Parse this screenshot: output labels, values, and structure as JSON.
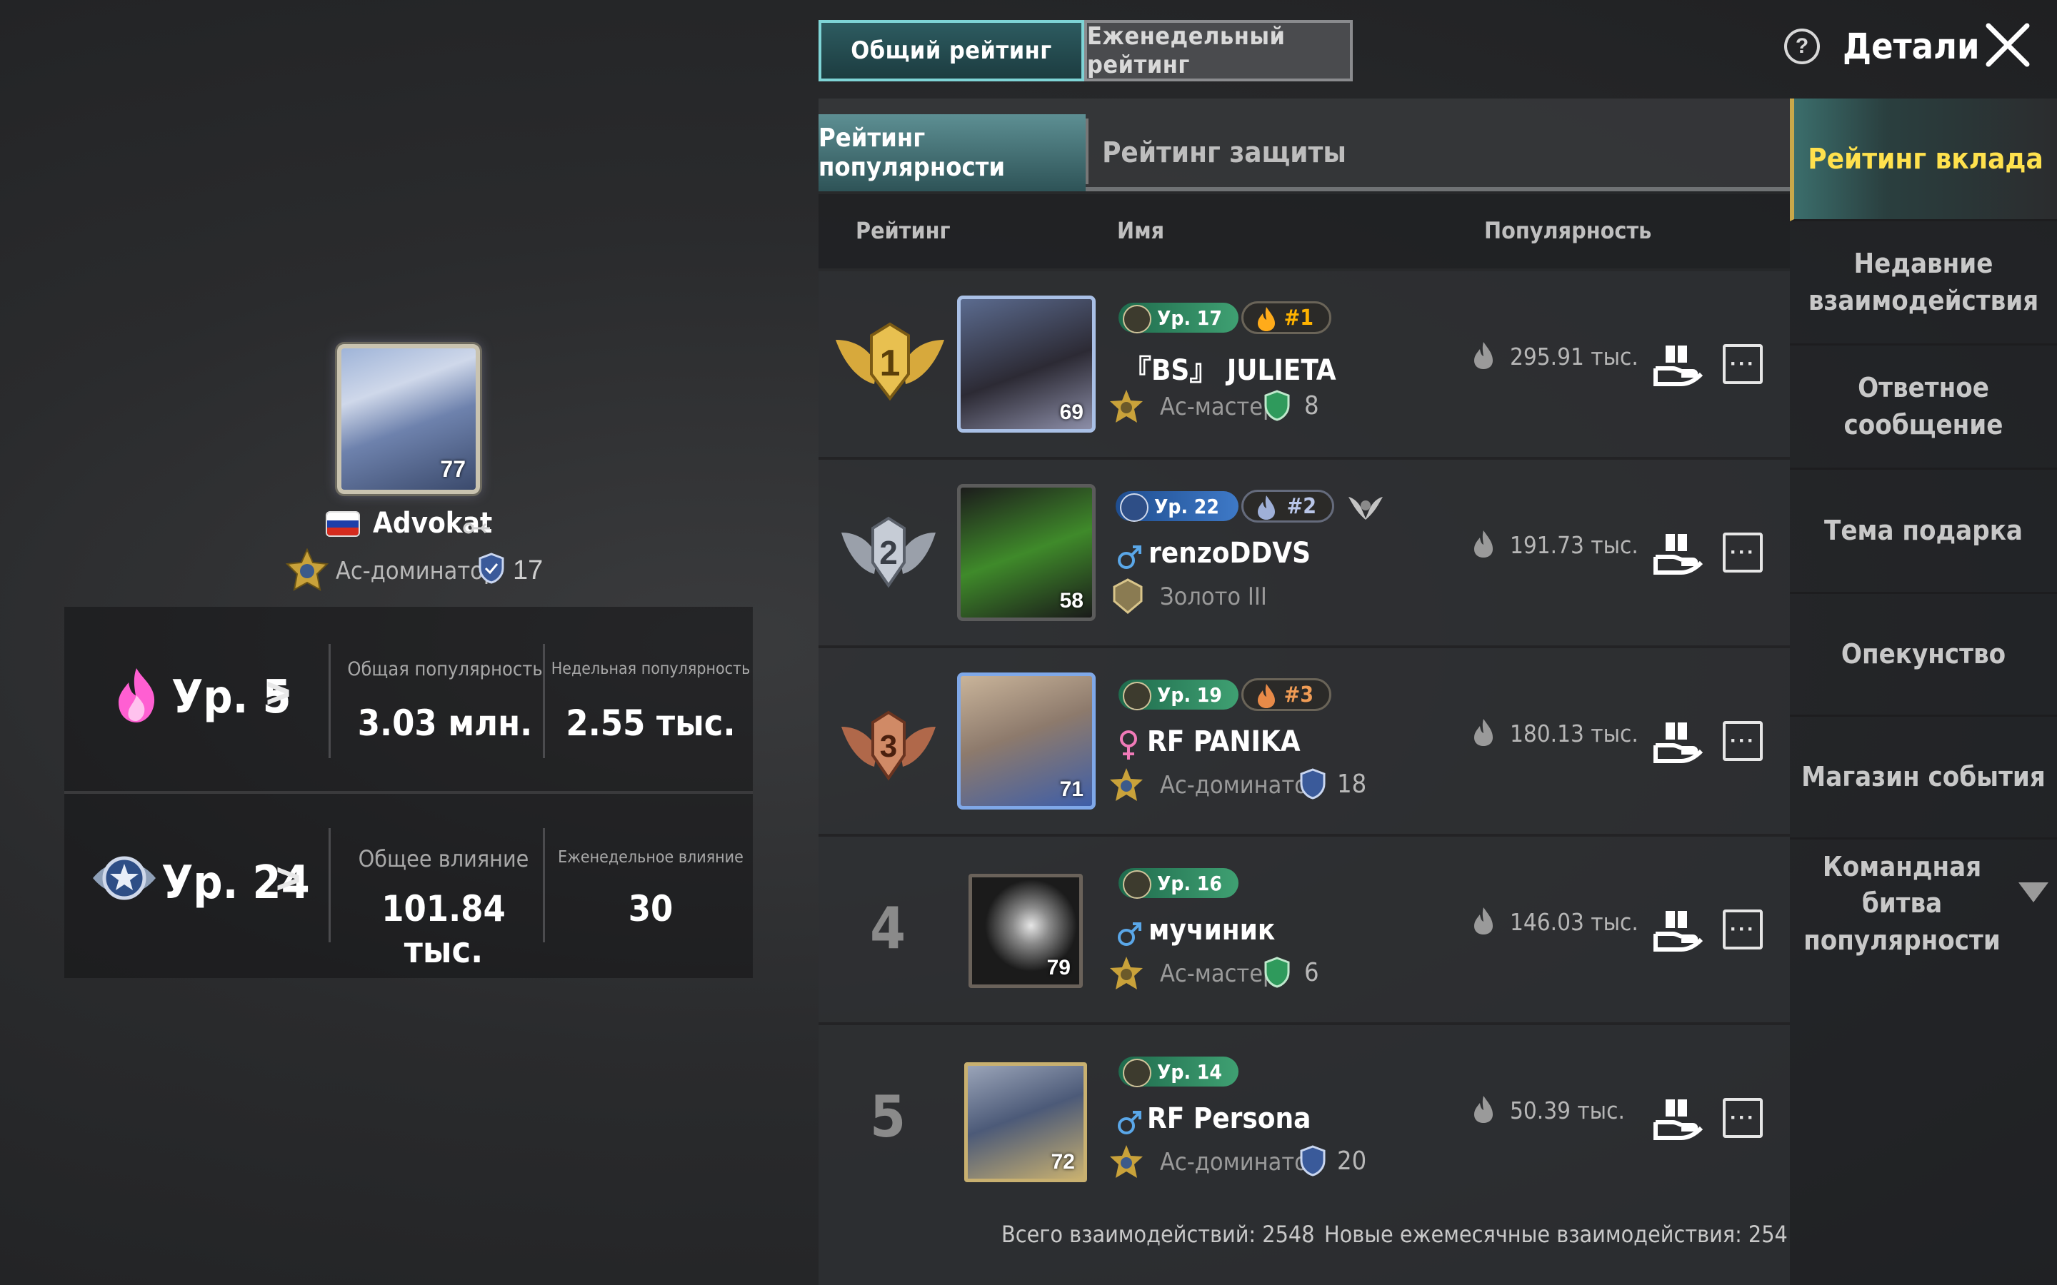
{
  "top_tabs": [
    {
      "label": "Общий рейтинг",
      "active": true
    },
    {
      "label": "Еженедельный рейтинг",
      "active": false
    }
  ],
  "header": {
    "details_label": "Детали",
    "help_icon": "question-icon",
    "close_icon": "close-icon"
  },
  "profile": {
    "avatar_level": "77",
    "flag": "russia-flag",
    "name": "Advokat",
    "tier": "Ас-доминатор",
    "tier_number": "17"
  },
  "popularity_stats": {
    "level_label": "Ур. 5",
    "total_label": "Общая популярность",
    "total_value": "3.03 млн.",
    "weekly_label": "Недельная популярность",
    "weekly_value": "2.55 тыс."
  },
  "influence_stats": {
    "level_label": "Ур. 24",
    "total_label": "Общее влияние",
    "total_value": "101.84 тыс.",
    "weekly_label": "Еженедельное влияние",
    "weekly_value": "30"
  },
  "sub_tabs": [
    {
      "label": "Рейтинг популярности",
      "active": true
    },
    {
      "label": "Рейтинг защиты",
      "active": false
    }
  ],
  "columns": {
    "rank": "Рейтинг",
    "name": "Имя",
    "popularity": "Популярность"
  },
  "rows": [
    {
      "rank": "1",
      "avatar_level": "69",
      "level": "Ур. 17",
      "badge": "#1",
      "name": "『BS』 JULIETA",
      "tier": "Ас-мастер",
      "tier_number": "8",
      "popularity": "295.91 тыс."
    },
    {
      "rank": "2",
      "avatar_level": "58",
      "level": "Ур. 22",
      "badge": "#2",
      "name": "renzoDDVS",
      "tier": "Золото III",
      "tier_number": "",
      "popularity": "191.73 тыс."
    },
    {
      "rank": "3",
      "avatar_level": "71",
      "level": "Ур. 19",
      "badge": "#3",
      "name": "RF PANIKA",
      "tier": "Ас-доминатор",
      "tier_number": "18",
      "popularity": "180.13 тыс."
    },
    {
      "rank": "4",
      "avatar_level": "79",
      "level": "Ур. 16",
      "badge": "",
      "name": "мучиник",
      "tier": "Ас-мастер",
      "tier_number": "6",
      "popularity": "146.03 тыс."
    },
    {
      "rank": "5",
      "avatar_level": "72",
      "level": "Ур. 14",
      "badge": "",
      "name": "RF Persona",
      "tier": "Ас-доминатор",
      "tier_number": "20",
      "popularity": "50.39 тыс."
    }
  ],
  "footer": {
    "total_interactions": "Всего взаимодействий: 2548",
    "monthly_interactions": "Новые ежемесячные взаимодействия: 254"
  },
  "sidebar": {
    "items": [
      {
        "label": "Рейтинг вклада",
        "active": true
      },
      {
        "label": "Недавние взаимодействия",
        "active": false
      },
      {
        "label": "Ответное сообщение",
        "active": false
      },
      {
        "label": "Тема подарка",
        "active": false
      },
      {
        "label": "Опекунство",
        "active": false
      },
      {
        "label": "Магазин события",
        "active": false
      },
      {
        "label": "Командная битва популярности",
        "active": false
      }
    ]
  },
  "colors": {
    "accent_teal": "#7ed4d6",
    "gold": "#ffe14d",
    "flame_pink": "#ff5fd2"
  }
}
